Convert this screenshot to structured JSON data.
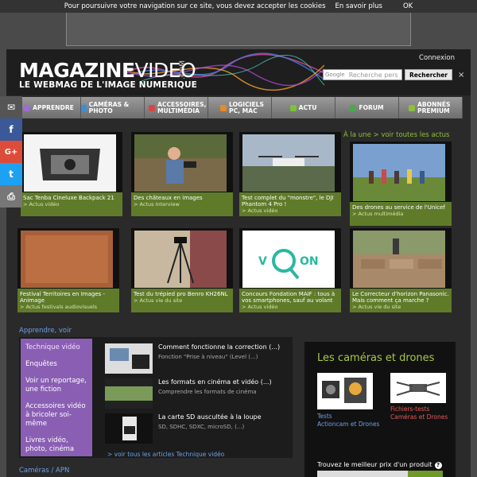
{
  "cookie": {
    "text": "Pour poursuivre votre navigation sur ce site, vous devez accepter les cookies",
    "more": "En savoir plus",
    "ok": "OK"
  },
  "header": {
    "logo_bold": "MAGAZINE",
    "logo_thin": "VIDEO",
    "logo_com": ".COM",
    "tagline": "LE WEBMAG DE L'IMAGE NUMERIQUE",
    "login": "Connexion",
    "search_google": "Google",
    "search_placeholder": "Recherche pers",
    "search_button": "Rechercher",
    "close": "×"
  },
  "nav": [
    {
      "label": "APPRENDRE",
      "icon": "star-icon",
      "color": "#9b6dd6"
    },
    {
      "label": "CAMÉRAS & PHOTO",
      "icon": "camera-icon",
      "color": "#3a8ed8"
    },
    {
      "label": "ACCESSOIRES, MULTIMÉDIA",
      "icon": "accessory-icon",
      "color": "#d64646"
    },
    {
      "label": "LOGICIELS PC, MAC",
      "icon": "software-icon",
      "color": "#e88a2a"
    },
    {
      "label": "ACTU",
      "icon": "news-icon",
      "color": "#7ac23a"
    },
    {
      "label": "FORUM",
      "icon": "forum-icon",
      "color": "#4aa84a"
    },
    {
      "label": "ABONNÉS PREMIUM",
      "icon": "premium-icon",
      "color": "#8ac23a"
    }
  ],
  "social": [
    {
      "name": "email",
      "glyph": "✉",
      "color": "#555555"
    },
    {
      "name": "facebook",
      "glyph": "f",
      "color": "#3b5998"
    },
    {
      "name": "googleplus",
      "glyph": "G+",
      "color": "#dd4b39"
    },
    {
      "name": "twitter",
      "glyph": "t",
      "color": "#1da1f2"
    },
    {
      "name": "print",
      "glyph": "⎙",
      "color": "#777777"
    }
  ],
  "actu_link": "À la une > voir toutes les actus",
  "tiles": [
    {
      "title": "Sac Tenba Cineluxe Backpack 21",
      "sub": "> Actus vidéo"
    },
    {
      "title": "Des châteaux en images",
      "sub": "> Actus Interview"
    },
    {
      "title": "Test complet du \"monstre\", le DJI Phantom 4 Pro !",
      "sub": "> Actus vidéo"
    },
    {
      "title": "Des drones au service de l'Unicef",
      "sub": "> Actus multimédia"
    },
    {
      "title": "Festival Territoires en Images - Animage",
      "sub": "> Actus festivals audiovisuels"
    },
    {
      "title": "Test du trépied pro Benro KH26NL",
      "sub": "> Actus vie du site"
    },
    {
      "title": "Concours Fondation MAIF : tous à vos smartphones, sauf au volant",
      "sub": "> Actus vidéo"
    },
    {
      "title": "Le Correcteur d'horizon Panasonic. Mais comment ça marche ?",
      "sub": "> Actus vie du site"
    }
  ],
  "learn": {
    "label": "Apprendre, voir",
    "menu": [
      "Technique vidéo",
      "Enquêtes",
      "Voir un reportage, une fiction",
      "Accessoires vidéo à bricoler soi-même",
      "Livres vidéo, photo, cinéma"
    ],
    "articles": [
      {
        "title": "Comment fonctionne la correction (...)",
        "desc": "Fonction \"Prise à niveau\" (Level (...)"
      },
      {
        "title": "Les formats en cinéma et vidéo (...)",
        "desc": "Comprendre les formats de cinéma"
      },
      {
        "title": "La carte SD auscultée à la loupe",
        "desc": "SD, SDHC, SDXC, microSD, (...)"
      }
    ],
    "more": "> voir tous les articles Technique vidéo"
  },
  "cams": {
    "title": "Les caméras et drones",
    "left_links": [
      "Tests",
      "Actioncam et Drones"
    ],
    "right_links": [
      "Fichiers-tests",
      "Caméras et Drones"
    ],
    "price_label": "Trouvez le meilleur prix d'un produit",
    "help": "?"
  },
  "footer_label": "Caméras / APN"
}
